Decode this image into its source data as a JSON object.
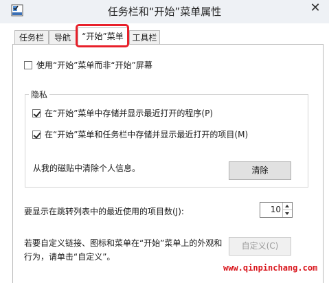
{
  "window": {
    "title": "任务栏和“开始”菜单属性",
    "close_glyph": "✕"
  },
  "tabs": [
    {
      "label": "任务栏"
    },
    {
      "label": "导航"
    },
    {
      "label": "“开始”菜单"
    },
    {
      "label": "工具栏"
    }
  ],
  "start_menu": {
    "use_start_menu_label": "使用“开始”菜单而非“开始”屏幕",
    "use_start_menu_checked": false,
    "privacy": {
      "title": "隐私",
      "store_programs_label": "在“开始”菜单中存储并显示最近打开的程序(P)",
      "store_programs_checked": true,
      "store_items_label": "在“开始”菜单和任务栏中存储并显示最近打开的项目(M)",
      "store_items_checked": true,
      "clear_text": "从我的磁贴中清除个人信息。",
      "clear_button": "清除"
    },
    "jumplist_label": "要显示在跳转列表中的最近使用的项目数(J):",
    "jumplist_value": "10",
    "customize_line1": "若要自定义链接、图标和菜单在“开始”菜单上的外观和",
    "customize_line2": "行为，请单击“自定义”。",
    "customize_button": "自定义(C)"
  },
  "watermark": "www.qinpinchang.com",
  "colors": {
    "highlight": "#e8202a",
    "watermark": "#d9141b"
  }
}
